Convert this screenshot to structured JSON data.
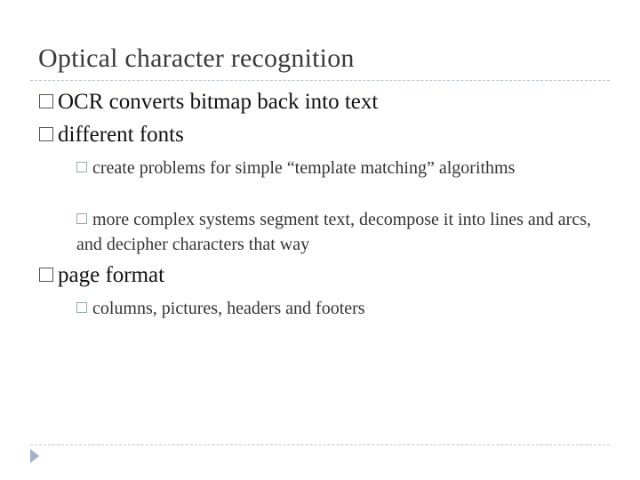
{
  "slide": {
    "title": "Optical character recognition",
    "bullets": [
      {
        "text": "OCR converts bitmap back into text"
      },
      {
        "text": "different fonts",
        "sub": [
          "create problems for simple “template matching” algorithms",
          "more complex systems segment text, decompose it into lines and arcs, and decipher characters that way"
        ]
      },
      {
        "text": "page format",
        "sub": [
          "columns, pictures, headers and footers"
        ]
      }
    ]
  },
  "icons": {
    "bullet": "square-bullet-icon",
    "nav": "triangle-right-icon"
  }
}
